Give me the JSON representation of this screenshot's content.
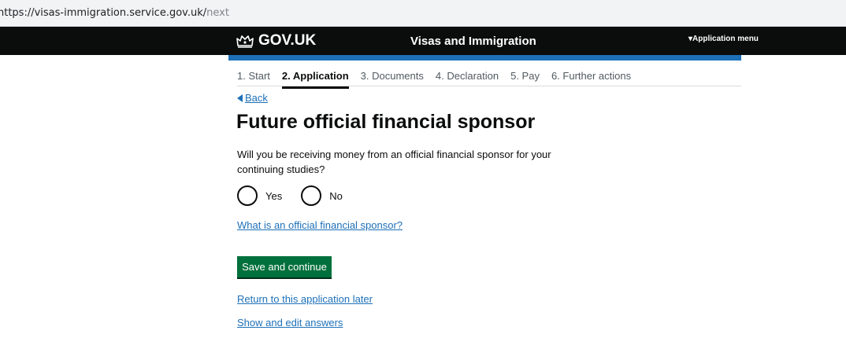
{
  "browser": {
    "url_main": "https://visas-immigration.service.gov.uk/",
    "url_path": "next"
  },
  "header": {
    "logo_text": "GOV.UK",
    "service_name": "Visas and Immigration",
    "menu_label": "▾Application menu"
  },
  "steps": [
    {
      "label": "1. Start",
      "current": false
    },
    {
      "label": "2. Application",
      "current": true
    },
    {
      "label": "3. Documents",
      "current": false
    },
    {
      "label": "4. Declaration",
      "current": false
    },
    {
      "label": "5. Pay",
      "current": false
    },
    {
      "label": "6. Further actions",
      "current": false
    }
  ],
  "back_label": "Back",
  "page_title": "Future official financial sponsor",
  "question": "Will you be receiving money from an official financial sponsor for your continuing studies?",
  "options": [
    {
      "label": "Yes",
      "selected": false
    },
    {
      "label": "No",
      "selected": false
    }
  ],
  "help_link": "What is an official financial sponsor?",
  "save_button": "Save and continue",
  "return_link": "Return to this application later",
  "edit_link": "Show and edit answers",
  "colors": {
    "header_bg": "#0b0c0c",
    "blue_bar": "#1d70b8",
    "link": "#1d70b8",
    "button": "#00703c"
  }
}
